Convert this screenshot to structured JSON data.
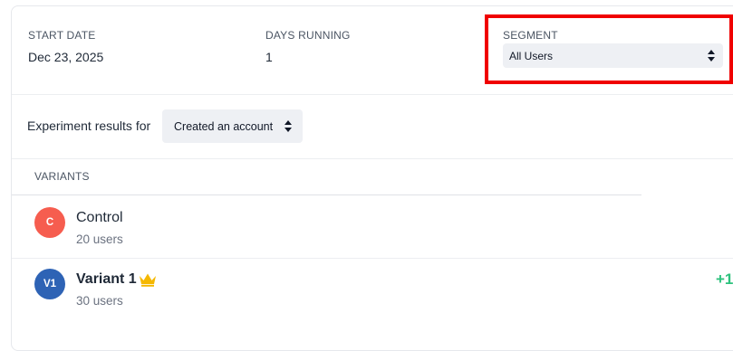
{
  "summary": {
    "start_date_label": "START DATE",
    "start_date_value": "Dec 23, 2025",
    "days_running_label": "DAYS RUNNING",
    "days_running_value": "1",
    "segment_label": "SEGMENT",
    "segment_value": "All Users"
  },
  "results": {
    "label": "Experiment results for",
    "event_value": "Created an account"
  },
  "variants": {
    "header": "VARIANTS",
    "items": [
      {
        "initials": "C",
        "name": "Control",
        "users": "20 users",
        "color": "#f65d4f",
        "winner": false
      },
      {
        "initials": "V1",
        "name": "Variant 1",
        "users": "30 users",
        "color": "#2e63b5",
        "winner": true,
        "lift": "+1"
      }
    ]
  },
  "colors": {
    "highlight": "#f00000",
    "positive": "#2ec27e",
    "crown": "#f5b800"
  }
}
